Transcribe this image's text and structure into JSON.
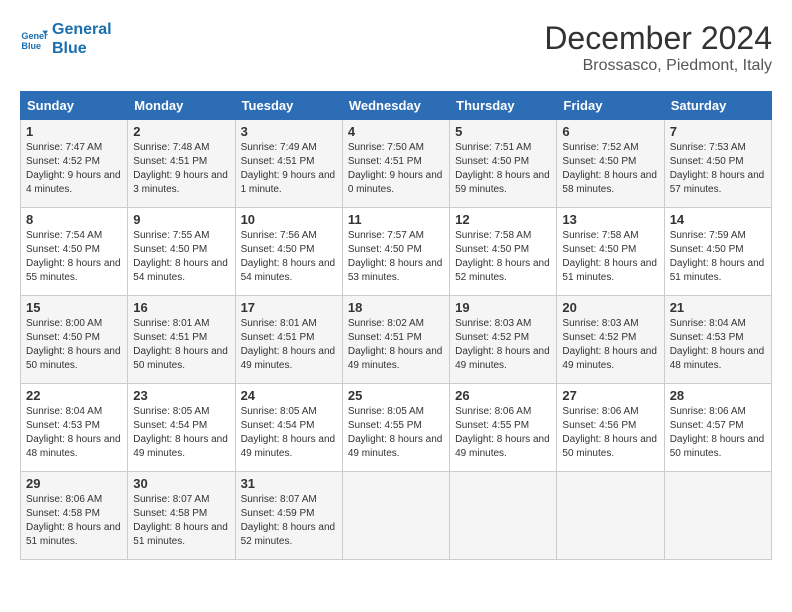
{
  "logo": {
    "line1": "General",
    "line2": "Blue"
  },
  "title": "December 2024",
  "location": "Brossasco, Piedmont, Italy",
  "days_header": [
    "Sunday",
    "Monday",
    "Tuesday",
    "Wednesday",
    "Thursday",
    "Friday",
    "Saturday"
  ],
  "weeks": [
    [
      {
        "day": "1",
        "sunrise": "Sunrise: 7:47 AM",
        "sunset": "Sunset: 4:52 PM",
        "daylight": "Daylight: 9 hours and 4 minutes."
      },
      {
        "day": "2",
        "sunrise": "Sunrise: 7:48 AM",
        "sunset": "Sunset: 4:51 PM",
        "daylight": "Daylight: 9 hours and 3 minutes."
      },
      {
        "day": "3",
        "sunrise": "Sunrise: 7:49 AM",
        "sunset": "Sunset: 4:51 PM",
        "daylight": "Daylight: 9 hours and 1 minute."
      },
      {
        "day": "4",
        "sunrise": "Sunrise: 7:50 AM",
        "sunset": "Sunset: 4:51 PM",
        "daylight": "Daylight: 9 hours and 0 minutes."
      },
      {
        "day": "5",
        "sunrise": "Sunrise: 7:51 AM",
        "sunset": "Sunset: 4:50 PM",
        "daylight": "Daylight: 8 hours and 59 minutes."
      },
      {
        "day": "6",
        "sunrise": "Sunrise: 7:52 AM",
        "sunset": "Sunset: 4:50 PM",
        "daylight": "Daylight: 8 hours and 58 minutes."
      },
      {
        "day": "7",
        "sunrise": "Sunrise: 7:53 AM",
        "sunset": "Sunset: 4:50 PM",
        "daylight": "Daylight: 8 hours and 57 minutes."
      }
    ],
    [
      {
        "day": "8",
        "sunrise": "Sunrise: 7:54 AM",
        "sunset": "Sunset: 4:50 PM",
        "daylight": "Daylight: 8 hours and 55 minutes."
      },
      {
        "day": "9",
        "sunrise": "Sunrise: 7:55 AM",
        "sunset": "Sunset: 4:50 PM",
        "daylight": "Daylight: 8 hours and 54 minutes."
      },
      {
        "day": "10",
        "sunrise": "Sunrise: 7:56 AM",
        "sunset": "Sunset: 4:50 PM",
        "daylight": "Daylight: 8 hours and 54 minutes."
      },
      {
        "day": "11",
        "sunrise": "Sunrise: 7:57 AM",
        "sunset": "Sunset: 4:50 PM",
        "daylight": "Daylight: 8 hours and 53 minutes."
      },
      {
        "day": "12",
        "sunrise": "Sunrise: 7:58 AM",
        "sunset": "Sunset: 4:50 PM",
        "daylight": "Daylight: 8 hours and 52 minutes."
      },
      {
        "day": "13",
        "sunrise": "Sunrise: 7:58 AM",
        "sunset": "Sunset: 4:50 PM",
        "daylight": "Daylight: 8 hours and 51 minutes."
      },
      {
        "day": "14",
        "sunrise": "Sunrise: 7:59 AM",
        "sunset": "Sunset: 4:50 PM",
        "daylight": "Daylight: 8 hours and 51 minutes."
      }
    ],
    [
      {
        "day": "15",
        "sunrise": "Sunrise: 8:00 AM",
        "sunset": "Sunset: 4:50 PM",
        "daylight": "Daylight: 8 hours and 50 minutes."
      },
      {
        "day": "16",
        "sunrise": "Sunrise: 8:01 AM",
        "sunset": "Sunset: 4:51 PM",
        "daylight": "Daylight: 8 hours and 50 minutes."
      },
      {
        "day": "17",
        "sunrise": "Sunrise: 8:01 AM",
        "sunset": "Sunset: 4:51 PM",
        "daylight": "Daylight: 8 hours and 49 minutes."
      },
      {
        "day": "18",
        "sunrise": "Sunrise: 8:02 AM",
        "sunset": "Sunset: 4:51 PM",
        "daylight": "Daylight: 8 hours and 49 minutes."
      },
      {
        "day": "19",
        "sunrise": "Sunrise: 8:03 AM",
        "sunset": "Sunset: 4:52 PM",
        "daylight": "Daylight: 8 hours and 49 minutes."
      },
      {
        "day": "20",
        "sunrise": "Sunrise: 8:03 AM",
        "sunset": "Sunset: 4:52 PM",
        "daylight": "Daylight: 8 hours and 49 minutes."
      },
      {
        "day": "21",
        "sunrise": "Sunrise: 8:04 AM",
        "sunset": "Sunset: 4:53 PM",
        "daylight": "Daylight: 8 hours and 48 minutes."
      }
    ],
    [
      {
        "day": "22",
        "sunrise": "Sunrise: 8:04 AM",
        "sunset": "Sunset: 4:53 PM",
        "daylight": "Daylight: 8 hours and 48 minutes."
      },
      {
        "day": "23",
        "sunrise": "Sunrise: 8:05 AM",
        "sunset": "Sunset: 4:54 PM",
        "daylight": "Daylight: 8 hours and 49 minutes."
      },
      {
        "day": "24",
        "sunrise": "Sunrise: 8:05 AM",
        "sunset": "Sunset: 4:54 PM",
        "daylight": "Daylight: 8 hours and 49 minutes."
      },
      {
        "day": "25",
        "sunrise": "Sunrise: 8:05 AM",
        "sunset": "Sunset: 4:55 PM",
        "daylight": "Daylight: 8 hours and 49 minutes."
      },
      {
        "day": "26",
        "sunrise": "Sunrise: 8:06 AM",
        "sunset": "Sunset: 4:55 PM",
        "daylight": "Daylight: 8 hours and 49 minutes."
      },
      {
        "day": "27",
        "sunrise": "Sunrise: 8:06 AM",
        "sunset": "Sunset: 4:56 PM",
        "daylight": "Daylight: 8 hours and 50 minutes."
      },
      {
        "day": "28",
        "sunrise": "Sunrise: 8:06 AM",
        "sunset": "Sunset: 4:57 PM",
        "daylight": "Daylight: 8 hours and 50 minutes."
      }
    ],
    [
      {
        "day": "29",
        "sunrise": "Sunrise: 8:06 AM",
        "sunset": "Sunset: 4:58 PM",
        "daylight": "Daylight: 8 hours and 51 minutes."
      },
      {
        "day": "30",
        "sunrise": "Sunrise: 8:07 AM",
        "sunset": "Sunset: 4:58 PM",
        "daylight": "Daylight: 8 hours and 51 minutes."
      },
      {
        "day": "31",
        "sunrise": "Sunrise: 8:07 AM",
        "sunset": "Sunset: 4:59 PM",
        "daylight": "Daylight: 8 hours and 52 minutes."
      },
      null,
      null,
      null,
      null
    ]
  ]
}
